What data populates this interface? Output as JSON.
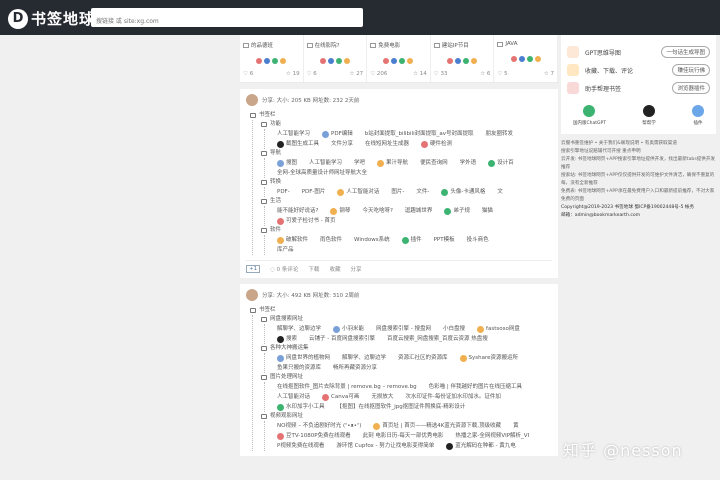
{
  "header": {
    "logo_glyph": "D",
    "logo_text": "书签地球",
    "search_placeholder": "搜链接 或 site:xg.com"
  },
  "colors": {
    "topbar": "#262a31",
    "accent_blue": "#4a7fd0",
    "accent_green": "#3cb371"
  },
  "categories": [
    {
      "name": "的品德班",
      "likes": "6",
      "stars": "19"
    },
    {
      "name": "在线影院?",
      "likes": "6",
      "stars": "27"
    },
    {
      "name": "免费电影",
      "likes": "206",
      "stars": "14"
    },
    {
      "name": "建站IP节目",
      "likes": "33",
      "stars": "6"
    },
    {
      "name": "JAVA",
      "likes": "5",
      "stars": "7"
    }
  ],
  "cards": [
    {
      "meta": "分享: 大小: 205 KB  网址数: 232  2天前",
      "root": "书签栏",
      "groups": [
        {
          "name": "功能",
          "rows": [
            [
              "人工智能学习",
              "PDF编辑",
              "b站封面提取_bilibili封面提取_av号封面提取",
              "朋友圈转发"
            ],
            [
              "截图生成工具",
              "文件分享",
              "在线短网址生成器",
              "硬件检测"
            ]
          ]
        },
        {
          "name": "导航",
          "rows": [
            [
              "搜图",
              "人工智能学习",
              "学吧",
              "果汁导航",
              "便民查询网",
              "学外语",
              "设计百"
            ],
            [
              "全网-全球高质量设计师网址导航大全"
            ]
          ]
        },
        {
          "name": "转换",
          "rows": [
            [
              "PDF-",
              "PDF-图片",
              "人工智能对话",
              "图片-",
              "文件-",
              "头像-卡通风格",
              "文"
            ]
          ]
        },
        {
          "name": "生活",
          "rows": [
            [
              "能不能好好说话?",
              "钢琴",
              "今天吃啥呀?",
              "逗趣城世界",
              "弟子规",
              "猫猫"
            ],
            [
              "可爱子检讨书 - 首页"
            ]
          ]
        },
        {
          "name": "软件",
          "rows": [
            [
              "破解软件",
              "雨色软件",
              "Windows系统",
              "插件",
              "PPT模板",
              "投斗商色"
            ],
            [
              "库产品"
            ]
          ]
        }
      ],
      "footer": {
        "tag": "+1",
        "likes": "0 条评论",
        "actions": [
          "下载",
          "收藏",
          "分享"
        ]
      }
    },
    {
      "meta": "分享: 大小: 492 KB  网址数: 310  2周前",
      "root": "书签栏",
      "groups": [
        {
          "name": "网盘搜索网址",
          "rows": [
            [
              "解聊学、边聊边学",
              "小羽米能",
              "网盘搜索引擎 - 搜盘网",
              "小白盘搜",
              "fastsoso网盘"
            ],
            [
              "搜索",
              "云铺子 - 百度网盘搜索引擎",
              "百度云搜索_网盘搜索_百度云资源 热盘搜"
            ]
          ]
        },
        {
          "name": "各种大神搬运集",
          "rows": [
            [
              "网盘世界的植物网",
              "解聊学、边聊边学",
              "资源汇社区的资源库",
              "Syshare资源搬运所"
            ],
            [
              "鱼果只搬的资源库",
              "畅所再藏资源分享"
            ]
          ]
        },
        {
          "name": "图片处理网址",
          "rows": [
            [
              "在线抠图软件_图片去除背景 | remove.bg – remove.bg",
              "色彩喵 | 伴我越好的图片在线压缩工具"
            ],
            [
              "人工智能对话",
              "Canva可画",
              "无损放大",
              "次水印证件-每份证加水印加水。证件加"
            ],
            [
              "水印加字小工具",
              "【抠图】在线抠图软件_jpg抠图证件照换底-精彩设计"
            ]
          ]
        },
        {
          "name": "视频观影网址",
          "rows": [
            [
              "NO视频 – 不负追剧好时光 (ᐢ•ᴥ•ᐢ)",
              "首页址 | 首页——精选4K蓝光资源下载,顶级收藏",
              "黄"
            ],
            [
              "豆TV-1080P免费在线观看",
              "此刻 电影日历-每天一部优秀电影",
              "热播之家-全网视频VIP解析_VI"
            ],
            [
              "P视频免费在线观看",
              "游环馆 Cupfox - 努力让找电影变得简单",
              "蓝光解码在种都 - 黄九电"
            ]
          ]
        }
      ]
    }
  ],
  "sidebar": {
    "rows": [
      {
        "label": "GPT思维导图",
        "button": "一句话生成导图"
      },
      {
        "label": "收藏、下载、评论",
        "button": "赚佳玩行佛"
      },
      {
        "label": "助手帮理书签",
        "button": "浏览器插件"
      }
    ],
    "apps": [
      "国内版ChatGPT",
      "帮帮学",
      "插件"
    ],
    "info": [
      "云服书重签维护 • 关于我们&联现说明 • 有奥需获取渠道",
      "搜索引擎地址说赔辅代可开搜 重点申明",
      "云开发: 书签地球网页+APP搜索引擎地址提供开发，找出最新tabs提供开发推荐",
      "搜索站: 书签地球网页+APP仅仅提供开发的可维护文件清洁，确保不重复的每，没有全新推荐",
      "免费表: 书签地球网页+APP承在最免费用户入口和最新提前推荐，不对大家免费的页面",
      "Copyright@2019-2023 书签地球 蜀ICP备19002448号-5 帐务",
      "邮箱：admin@bookmarkearth.com"
    ]
  },
  "watermark": "知乎 @nesson"
}
